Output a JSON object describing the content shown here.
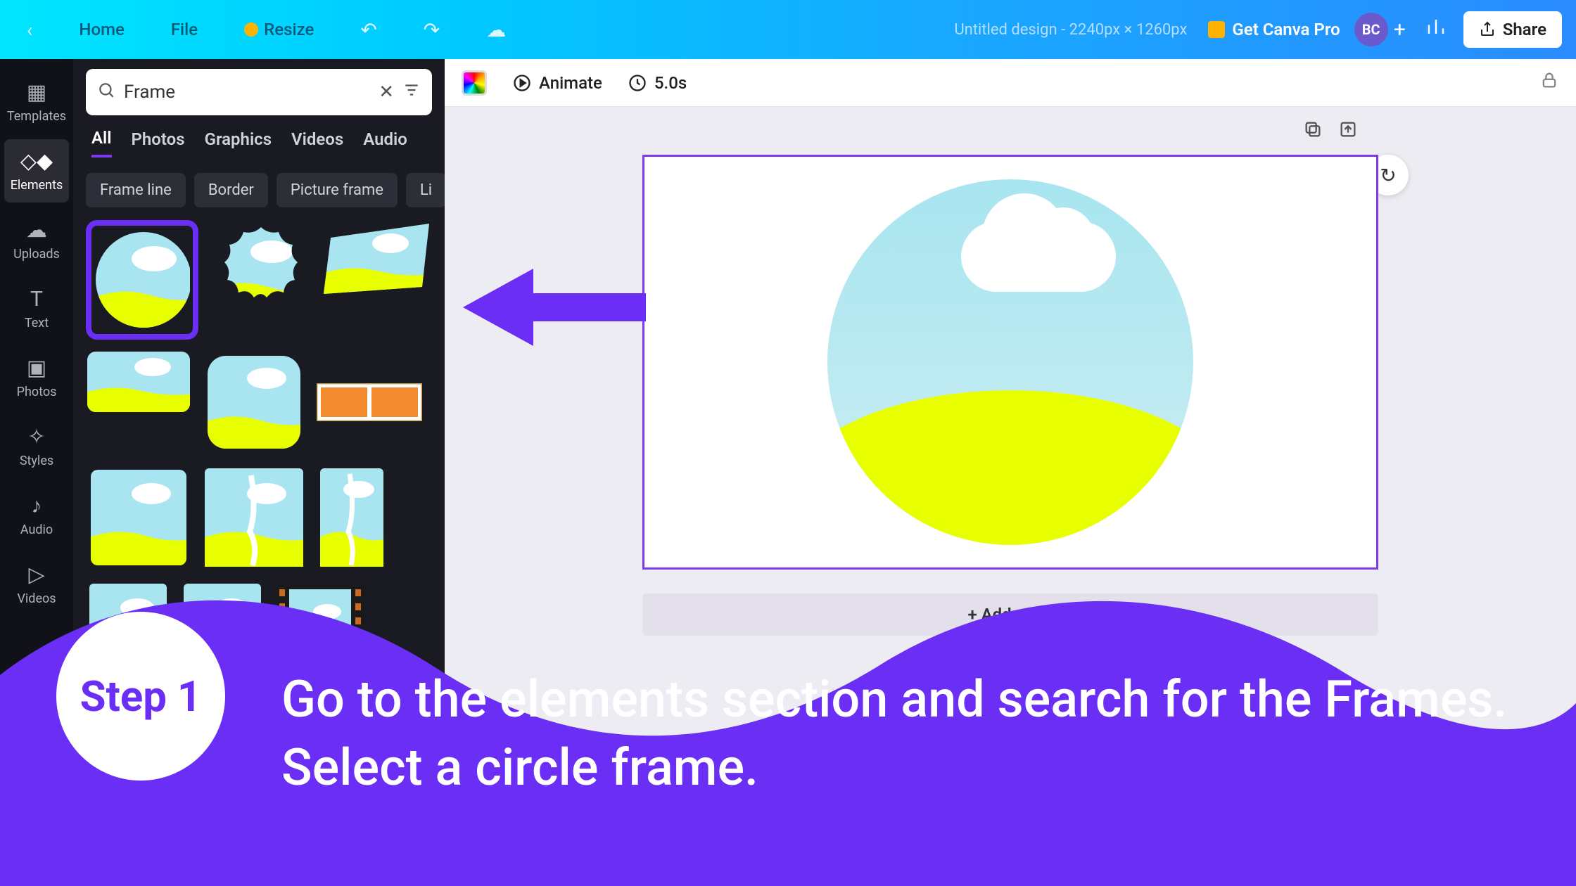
{
  "topbar": {
    "home": "Home",
    "file": "File",
    "resize": "Resize",
    "title": "Untitled design - 2240px × 1260px",
    "pro": "Get Canva Pro",
    "avatar": "BC",
    "share": "Share"
  },
  "rail": {
    "items": [
      {
        "label": "Templates"
      },
      {
        "label": "Elements"
      },
      {
        "label": "Uploads"
      },
      {
        "label": "Text"
      },
      {
        "label": "Photos"
      },
      {
        "label": "Styles"
      },
      {
        "label": "Audio"
      },
      {
        "label": "Videos"
      }
    ]
  },
  "panel": {
    "search_value": "Frame",
    "tabs": [
      "All",
      "Photos",
      "Graphics",
      "Videos",
      "Audio"
    ],
    "chips": [
      "Frame line",
      "Border",
      "Picture frame",
      "Li"
    ]
  },
  "ctoolbar": {
    "animate": "Animate",
    "duration": "5.0s"
  },
  "canvas": {
    "add_page": "+ Add page"
  },
  "banner": {
    "step": "Step 1",
    "text": "Go to the elements section and search for the Frames. Select a circle frame."
  }
}
